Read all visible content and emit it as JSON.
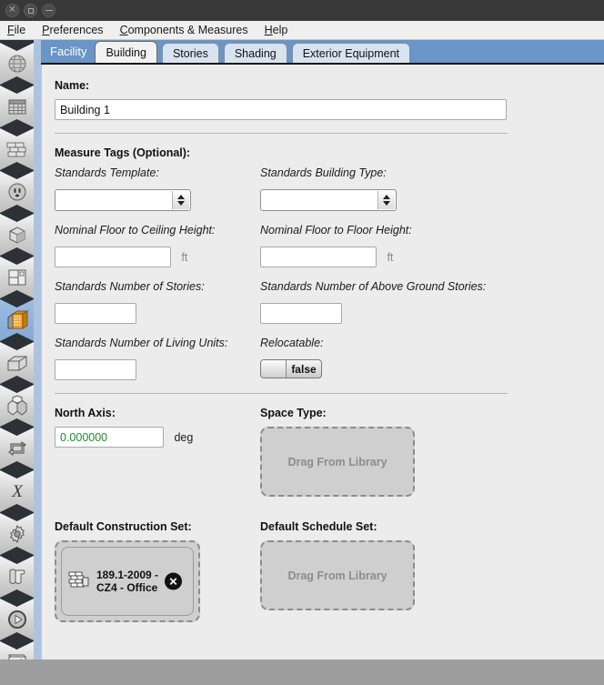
{
  "window": {
    "buttons": [
      {
        "name": "close",
        "glyph": "×"
      },
      {
        "name": "maximize",
        "glyph": ""
      },
      {
        "name": "minimize",
        "glyph": ""
      }
    ]
  },
  "menubar": {
    "items": [
      {
        "mnemonic": "F",
        "rest": "ile"
      },
      {
        "mnemonic": "P",
        "rest": "references"
      },
      {
        "mnemonic": "C",
        "rest": "omponents & Measures"
      },
      {
        "mnemonic": "H",
        "rest": "elp"
      }
    ]
  },
  "sidebar": {
    "items": [
      {
        "label": "Site",
        "icon": "globe-icon",
        "selected": false
      },
      {
        "label": "Schedules",
        "icon": "calendar-icon",
        "selected": false
      },
      {
        "label": "Constructions",
        "icon": "brick-wall-icon",
        "selected": false
      },
      {
        "label": "Loads",
        "icon": "power-outlet-icon",
        "selected": false
      },
      {
        "label": "Space Types",
        "icon": "cube-split-icon",
        "selected": false
      },
      {
        "label": "Geometry",
        "icon": "floorplan-icon",
        "selected": false
      },
      {
        "label": "Facility",
        "icon": "building-icon",
        "selected": true
      },
      {
        "label": "Spaces",
        "icon": "box-icon",
        "selected": false
      },
      {
        "label": "Thermal Zones",
        "icon": "cube-group-icon",
        "selected": false
      },
      {
        "label": "HVAC Systems",
        "icon": "loop-arrows-icon",
        "selected": false
      },
      {
        "label": "Variables",
        "icon": "x-variable-icon",
        "selected": false
      },
      {
        "label": "Simulation Settings",
        "icon": "gear-icon",
        "selected": false
      },
      {
        "label": "Measures",
        "icon": "scroll-icon",
        "selected": false
      },
      {
        "label": "Run Simulation",
        "icon": "play-icon",
        "selected": false
      },
      {
        "label": "Results Summary",
        "icon": "bar-chart-icon",
        "selected": false
      }
    ]
  },
  "tabstrip": {
    "group_label": "Facility",
    "tabs": [
      {
        "label": "Building",
        "active": true
      },
      {
        "label": "Stories",
        "active": false
      },
      {
        "label": "Shading",
        "active": false
      },
      {
        "label": "Exterior Equipment",
        "active": false
      }
    ]
  },
  "form": {
    "name_label": "Name:",
    "name_value": "Building 1",
    "measure_tags_label": "Measure Tags (Optional):",
    "standards_template": {
      "label": "Standards Template:",
      "value": ""
    },
    "standards_building_type": {
      "label": "Standards Building Type:",
      "value": ""
    },
    "floor_to_ceiling": {
      "label": "Nominal Floor to Ceiling Height:",
      "value": "",
      "unit": "ft"
    },
    "floor_to_floor": {
      "label": "Nominal Floor to Floor Height:",
      "value": "",
      "unit": "ft"
    },
    "num_stories": {
      "label": "Standards Number of Stories:",
      "value": ""
    },
    "num_above_ground_stories": {
      "label": "Standards Number of Above Ground Stories:",
      "value": ""
    },
    "num_living_units": {
      "label": "Standards Number of Living Units:",
      "value": ""
    },
    "relocatable": {
      "label": "Relocatable:",
      "value": "false"
    },
    "north_axis": {
      "label": "North Axis:",
      "value": "0.000000",
      "unit": "deg",
      "value_color": "#1f8a2f"
    },
    "space_type": {
      "label": "Space Type:",
      "placeholder": "Drag From Library"
    },
    "default_construction_set": {
      "label": "Default Construction Set:",
      "card_name": "189.1-2009 - CZ4 - Office",
      "card_icon": "brick-wall-icon",
      "remove_glyph": "✕"
    },
    "default_schedule_set": {
      "label": "Default Schedule Set:",
      "placeholder": "Drag From Library"
    }
  }
}
